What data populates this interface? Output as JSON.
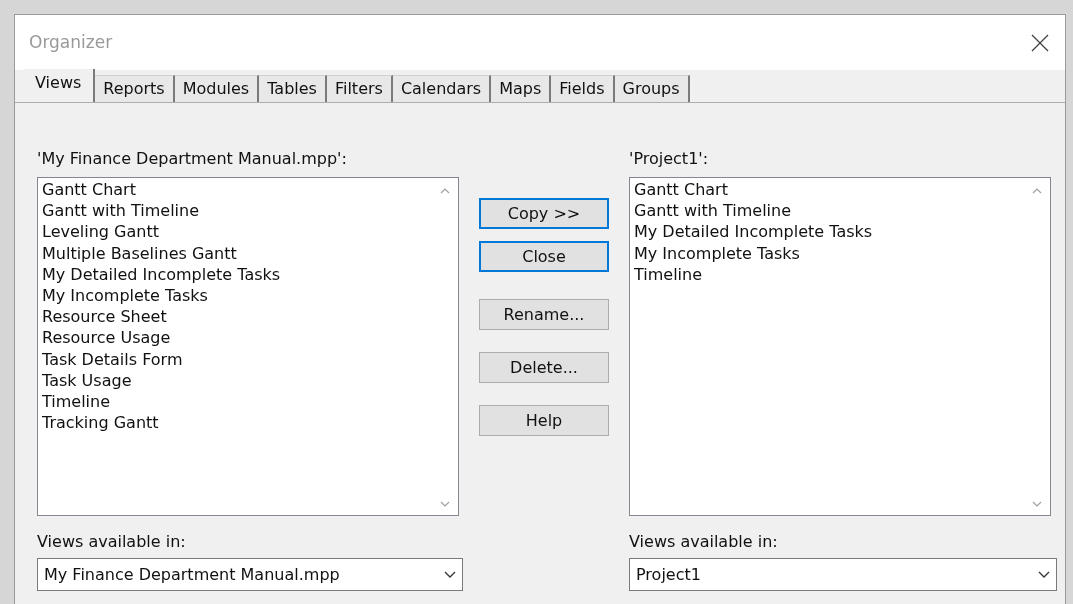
{
  "window": {
    "title": "Organizer"
  },
  "tabs": [
    {
      "label": "Views",
      "selected": true
    },
    {
      "label": "Reports",
      "selected": false
    },
    {
      "label": "Modules",
      "selected": false
    },
    {
      "label": "Tables",
      "selected": false
    },
    {
      "label": "Filters",
      "selected": false
    },
    {
      "label": "Calendars",
      "selected": false
    },
    {
      "label": "Maps",
      "selected": false
    },
    {
      "label": "Fields",
      "selected": false
    },
    {
      "label": "Groups",
      "selected": false
    }
  ],
  "left": {
    "label": "'My Finance Department Manual.mpp':",
    "items": [
      "Gantt Chart",
      "Gantt with Timeline",
      "Leveling Gantt",
      "Multiple Baselines Gantt",
      "My Detailed Incomplete Tasks",
      "My Incomplete Tasks",
      "Resource Sheet",
      "Resource Usage",
      "Task Details Form",
      "Task Usage",
      "Timeline",
      "Tracking Gantt"
    ],
    "available_label": "Views available in:",
    "available_value": "My Finance Department Manual.mpp"
  },
  "buttons": [
    {
      "label": "Copy >>",
      "focused": true
    },
    {
      "label": "Close",
      "focused": true
    },
    {
      "label": "Rename...",
      "focused": false
    },
    {
      "label": "Delete...",
      "focused": false
    },
    {
      "label": "Help",
      "focused": false
    }
  ],
  "right": {
    "label": "'Project1':",
    "items": [
      "Gantt Chart",
      "Gantt with Timeline",
      "My Detailed Incomplete Tasks",
      "My Incomplete Tasks",
      "Timeline"
    ],
    "available_label": "Views available in:",
    "available_value": "Project1"
  }
}
